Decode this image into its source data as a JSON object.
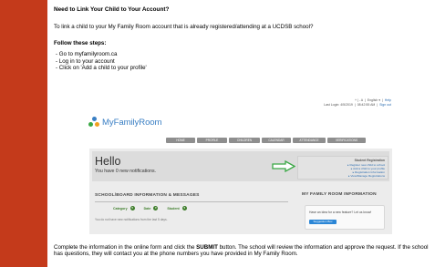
{
  "doc": {
    "heading": "Need to Link Your Child to Your Account?",
    "intro": "To link a child to your My Family Room account that is already registered/attending at a UCDSB school?",
    "steps_title": "Follow these steps:",
    "steps": [
      "- Go to myfamilyroom.ca",
      "- Log in to your account",
      "- Click on 'Add a child to your profile'"
    ],
    "outro_pre": "Complete the information in the online form and click the ",
    "outro_bold": "SUBMIT",
    "outro_post": " button. The school will review the information and approve the request.  If the school has questions, they will contact you at the phone numbers you have provided in My Family Room."
  },
  "screenshot": {
    "topbar": {
      "font_controls": "+ | - A",
      "language": "English",
      "help": "Help",
      "last_login": "Last Login: 4/5/2019",
      "time": "08:42:55 AM",
      "sign_out": "Sign out"
    },
    "logo_text": "MyFamilyRoom",
    "nav": [
      "HOME",
      "PROFILE",
      "CHILDREN",
      "CALENDAR",
      "ATTENDANCE",
      "VERIFICATIONS"
    ],
    "hello": "Hello",
    "notifications": "You have 0 new notifications.",
    "student_registration": {
      "title": "Student Registration",
      "links": [
        "Register new child to school",
        "Add a child to your profile",
        "Registration Information",
        "View/Manage Registrations"
      ]
    },
    "school_title": "SCHOOL/BOARD INFORMATION & MESSAGES",
    "family_title": "MY FAMILY ROOM INFORMATION",
    "filters": [
      "Category",
      "Date",
      "Student"
    ],
    "no_notifications": "You do not have new notifications from the last 5 days.",
    "idea_text": "Have an idea for a new feature? Let us know!",
    "idea_button": "Suggestion Box"
  },
  "colors": {
    "page_bg": "#c43a1b",
    "brand_blue": "#3a7fc4",
    "arrow_green": "#3aa845",
    "filter_green": "#3d7d2a"
  }
}
